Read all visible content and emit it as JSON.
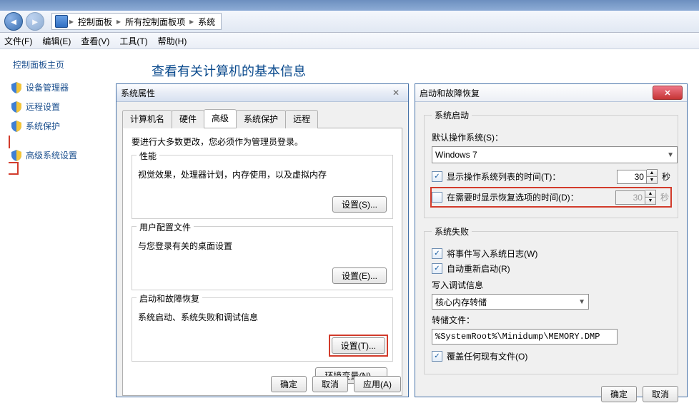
{
  "breadcrumb": {
    "a": "控制面板",
    "b": "所有控制面板项",
    "c": "系统"
  },
  "menu": {
    "file": "文件(F)",
    "edit": "编辑(E)",
    "view": "查看(V)",
    "tools": "工具(T)",
    "help": "帮助(H)"
  },
  "leftnav": {
    "title": "控制面板主页",
    "items": [
      "设备管理器",
      "远程设置",
      "系统保护",
      "高级系统设置"
    ]
  },
  "page_title": "查看有关计算机的基本信息",
  "sp": {
    "title": "系统属性",
    "tabs": [
      "计算机名",
      "硬件",
      "高级",
      "系统保护",
      "远程"
    ],
    "admin_note": "要进行大多数更改，您必须作为管理员登录。",
    "perf": {
      "title": "性能",
      "desc": "视觉效果，处理器计划，内存使用，以及虚拟内存",
      "btn": "设置(S)..."
    },
    "prof": {
      "title": "用户配置文件",
      "desc": "与您登录有关的桌面设置",
      "btn": "设置(E)..."
    },
    "start": {
      "title": "启动和故障恢复",
      "desc": "系统启动、系统失败和调试信息",
      "btn": "设置(T)..."
    },
    "envbtn": "环境变量(N)...",
    "ok": "确定",
    "cancel": "取消",
    "apply": "应用(A)"
  },
  "sr": {
    "title": "启动和故障恢复",
    "startup": {
      "legend": "系统启动",
      "default_os_label": "默认操作系统(S)：",
      "default_os": "Windows 7",
      "show_os_list": "显示操作系统列表的时间(T)：",
      "show_os_list_val": "30",
      "show_recovery": "在需要时显示恢复选项的时间(D)：",
      "show_recovery_val": "30",
      "sec": "秒"
    },
    "failure": {
      "legend": "系统失败",
      "log_event": "将事件写入系统日志(W)",
      "auto_restart": "自动重新启动(R)",
      "write_debug": "写入调试信息",
      "dump_type": "核心内存转储",
      "dump_file_label": "转储文件：",
      "dump_file": "%SystemRoot%\\Minidump\\MEMORY.DMP",
      "overwrite": "覆盖任何现有文件(O)"
    },
    "ok": "确定",
    "cancel": "取消"
  }
}
